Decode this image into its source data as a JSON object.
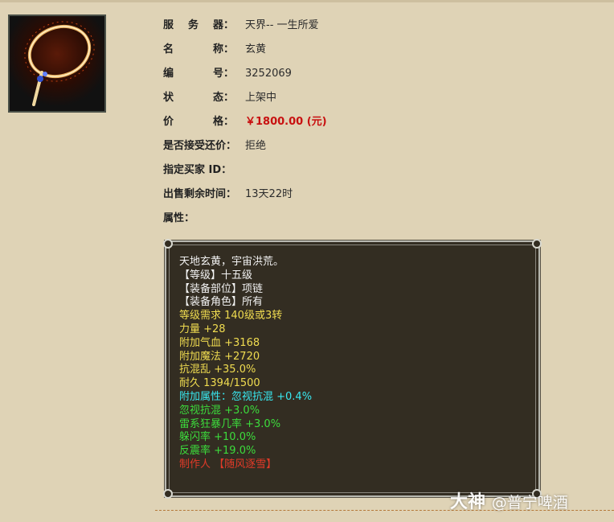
{
  "item": {
    "icon": "necklace-icon",
    "fields": [
      {
        "label": "服务器",
        "value": "天界-- 一生所爱"
      },
      {
        "label": "名称",
        "value": "玄黄"
      },
      {
        "label": "编号",
        "value": "3252069"
      },
      {
        "label": "状态",
        "value": "上架中"
      },
      {
        "label": "价格",
        "value": "￥1800.00 (元)"
      },
      {
        "label": "是否接受还价",
        "value": "拒绝"
      },
      {
        "label": "指定买家 ID",
        "value": ""
      },
      {
        "label": "出售剩余时间",
        "value": "13天22时"
      },
      {
        "label": "属性",
        "value": ""
      }
    ],
    "label_chars": {
      "server": [
        "服",
        "务",
        "器："
      ],
      "name": [
        "名",
        "称："
      ],
      "id": [
        "编",
        "号："
      ],
      "status": [
        "状",
        "态："
      ],
      "price": [
        "价",
        "格："
      ],
      "bargain": "是否接受还价：",
      "buyer": "指定买家 ID：",
      "time_left": "出售剩余时间：",
      "attributes": "属性："
    }
  },
  "tooltip": {
    "lines": [
      {
        "text": "天地玄黄，宇宙洪荒。",
        "color": "#f2f2f2"
      },
      {
        "text": "【等级】十五级",
        "color": "#f2f2f2"
      },
      {
        "text": "【装备部位】项链",
        "color": "#f2f2f2"
      },
      {
        "text": "【装备角色】所有",
        "color": "#f2f2f2"
      },
      {
        "text": "等级需求 140级或3转",
        "color": "#f0dc50"
      },
      {
        "text": "力量 +28",
        "color": "#f0dc50"
      },
      {
        "text": "附加气血 +3168",
        "color": "#f0dc50"
      },
      {
        "text": "附加魔法 +2720",
        "color": "#f0dc50"
      },
      {
        "text": "抗混乱 +35.0%",
        "color": "#f0dc50"
      },
      {
        "text": "耐久 1394/1500",
        "color": "#f0dc50"
      },
      {
        "text": "附加属性：忽视抗混 +0.4%",
        "color": "#38e8f0"
      },
      {
        "text": "忽视抗混 +3.0%",
        "color": "#3cdc3c"
      },
      {
        "text": "雷系狂暴几率 +3.0%",
        "color": "#3cdc3c"
      },
      {
        "text": "躲闪率 +10.0%",
        "color": "#3cdc3c"
      },
      {
        "text": "反震率 +19.0%",
        "color": "#3cdc3c"
      },
      {
        "text": "制作人 【随风逐雪】",
        "color": "#e03a28"
      }
    ]
  },
  "watermark": {
    "brand": "大神",
    "handle": "@普宁啤酒"
  }
}
